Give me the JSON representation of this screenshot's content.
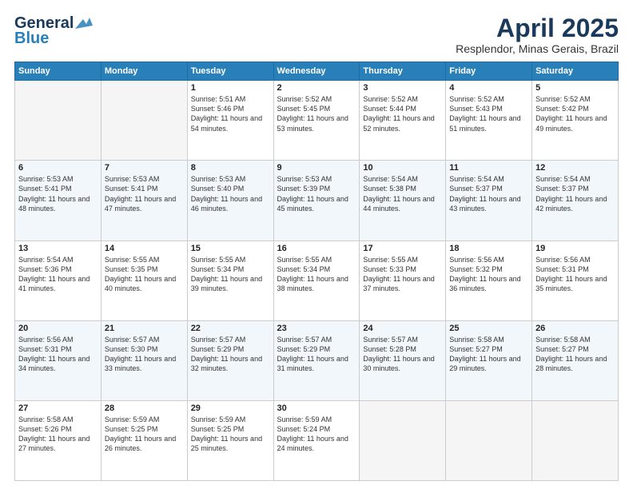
{
  "header": {
    "logo_line1": "General",
    "logo_line2": "Blue",
    "month_title": "April 2025",
    "location": "Resplendor, Minas Gerais, Brazil"
  },
  "weekdays": [
    "Sunday",
    "Monday",
    "Tuesday",
    "Wednesday",
    "Thursday",
    "Friday",
    "Saturday"
  ],
  "weeks": [
    [
      {
        "day": "",
        "info": ""
      },
      {
        "day": "",
        "info": ""
      },
      {
        "day": "1",
        "info": "Sunrise: 5:51 AM\nSunset: 5:46 PM\nDaylight: 11 hours and 54 minutes."
      },
      {
        "day": "2",
        "info": "Sunrise: 5:52 AM\nSunset: 5:45 PM\nDaylight: 11 hours and 53 minutes."
      },
      {
        "day": "3",
        "info": "Sunrise: 5:52 AM\nSunset: 5:44 PM\nDaylight: 11 hours and 52 minutes."
      },
      {
        "day": "4",
        "info": "Sunrise: 5:52 AM\nSunset: 5:43 PM\nDaylight: 11 hours and 51 minutes."
      },
      {
        "day": "5",
        "info": "Sunrise: 5:52 AM\nSunset: 5:42 PM\nDaylight: 11 hours and 49 minutes."
      }
    ],
    [
      {
        "day": "6",
        "info": "Sunrise: 5:53 AM\nSunset: 5:41 PM\nDaylight: 11 hours and 48 minutes."
      },
      {
        "day": "7",
        "info": "Sunrise: 5:53 AM\nSunset: 5:41 PM\nDaylight: 11 hours and 47 minutes."
      },
      {
        "day": "8",
        "info": "Sunrise: 5:53 AM\nSunset: 5:40 PM\nDaylight: 11 hours and 46 minutes."
      },
      {
        "day": "9",
        "info": "Sunrise: 5:53 AM\nSunset: 5:39 PM\nDaylight: 11 hours and 45 minutes."
      },
      {
        "day": "10",
        "info": "Sunrise: 5:54 AM\nSunset: 5:38 PM\nDaylight: 11 hours and 44 minutes."
      },
      {
        "day": "11",
        "info": "Sunrise: 5:54 AM\nSunset: 5:37 PM\nDaylight: 11 hours and 43 minutes."
      },
      {
        "day": "12",
        "info": "Sunrise: 5:54 AM\nSunset: 5:37 PM\nDaylight: 11 hours and 42 minutes."
      }
    ],
    [
      {
        "day": "13",
        "info": "Sunrise: 5:54 AM\nSunset: 5:36 PM\nDaylight: 11 hours and 41 minutes."
      },
      {
        "day": "14",
        "info": "Sunrise: 5:55 AM\nSunset: 5:35 PM\nDaylight: 11 hours and 40 minutes."
      },
      {
        "day": "15",
        "info": "Sunrise: 5:55 AM\nSunset: 5:34 PM\nDaylight: 11 hours and 39 minutes."
      },
      {
        "day": "16",
        "info": "Sunrise: 5:55 AM\nSunset: 5:34 PM\nDaylight: 11 hours and 38 minutes."
      },
      {
        "day": "17",
        "info": "Sunrise: 5:55 AM\nSunset: 5:33 PM\nDaylight: 11 hours and 37 minutes."
      },
      {
        "day": "18",
        "info": "Sunrise: 5:56 AM\nSunset: 5:32 PM\nDaylight: 11 hours and 36 minutes."
      },
      {
        "day": "19",
        "info": "Sunrise: 5:56 AM\nSunset: 5:31 PM\nDaylight: 11 hours and 35 minutes."
      }
    ],
    [
      {
        "day": "20",
        "info": "Sunrise: 5:56 AM\nSunset: 5:31 PM\nDaylight: 11 hours and 34 minutes."
      },
      {
        "day": "21",
        "info": "Sunrise: 5:57 AM\nSunset: 5:30 PM\nDaylight: 11 hours and 33 minutes."
      },
      {
        "day": "22",
        "info": "Sunrise: 5:57 AM\nSunset: 5:29 PM\nDaylight: 11 hours and 32 minutes."
      },
      {
        "day": "23",
        "info": "Sunrise: 5:57 AM\nSunset: 5:29 PM\nDaylight: 11 hours and 31 minutes."
      },
      {
        "day": "24",
        "info": "Sunrise: 5:57 AM\nSunset: 5:28 PM\nDaylight: 11 hours and 30 minutes."
      },
      {
        "day": "25",
        "info": "Sunrise: 5:58 AM\nSunset: 5:27 PM\nDaylight: 11 hours and 29 minutes."
      },
      {
        "day": "26",
        "info": "Sunrise: 5:58 AM\nSunset: 5:27 PM\nDaylight: 11 hours and 28 minutes."
      }
    ],
    [
      {
        "day": "27",
        "info": "Sunrise: 5:58 AM\nSunset: 5:26 PM\nDaylight: 11 hours and 27 minutes."
      },
      {
        "day": "28",
        "info": "Sunrise: 5:59 AM\nSunset: 5:25 PM\nDaylight: 11 hours and 26 minutes."
      },
      {
        "day": "29",
        "info": "Sunrise: 5:59 AM\nSunset: 5:25 PM\nDaylight: 11 hours and 25 minutes."
      },
      {
        "day": "30",
        "info": "Sunrise: 5:59 AM\nSunset: 5:24 PM\nDaylight: 11 hours and 24 minutes."
      },
      {
        "day": "",
        "info": ""
      },
      {
        "day": "",
        "info": ""
      },
      {
        "day": "",
        "info": ""
      }
    ]
  ]
}
